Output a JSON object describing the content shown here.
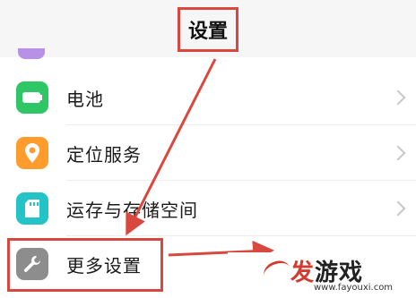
{
  "header": {
    "title": "设置"
  },
  "settings": {
    "items": [
      {
        "label": "电池",
        "icon": "battery-icon",
        "color": "#2fc765"
      },
      {
        "label": "定位服务",
        "icon": "location-pin-icon",
        "color": "#ff9c2b"
      },
      {
        "label": "运存与存储空间",
        "icon": "sd-card-icon",
        "color": "#23c3c8"
      },
      {
        "label": "更多设置",
        "icon": "wrench-icon",
        "color": "#8d8d8d"
      }
    ]
  },
  "annotation": {
    "color": "#d9483e"
  },
  "watermark": {
    "brand": "发游戏",
    "url": "www.fayouxi.com"
  }
}
